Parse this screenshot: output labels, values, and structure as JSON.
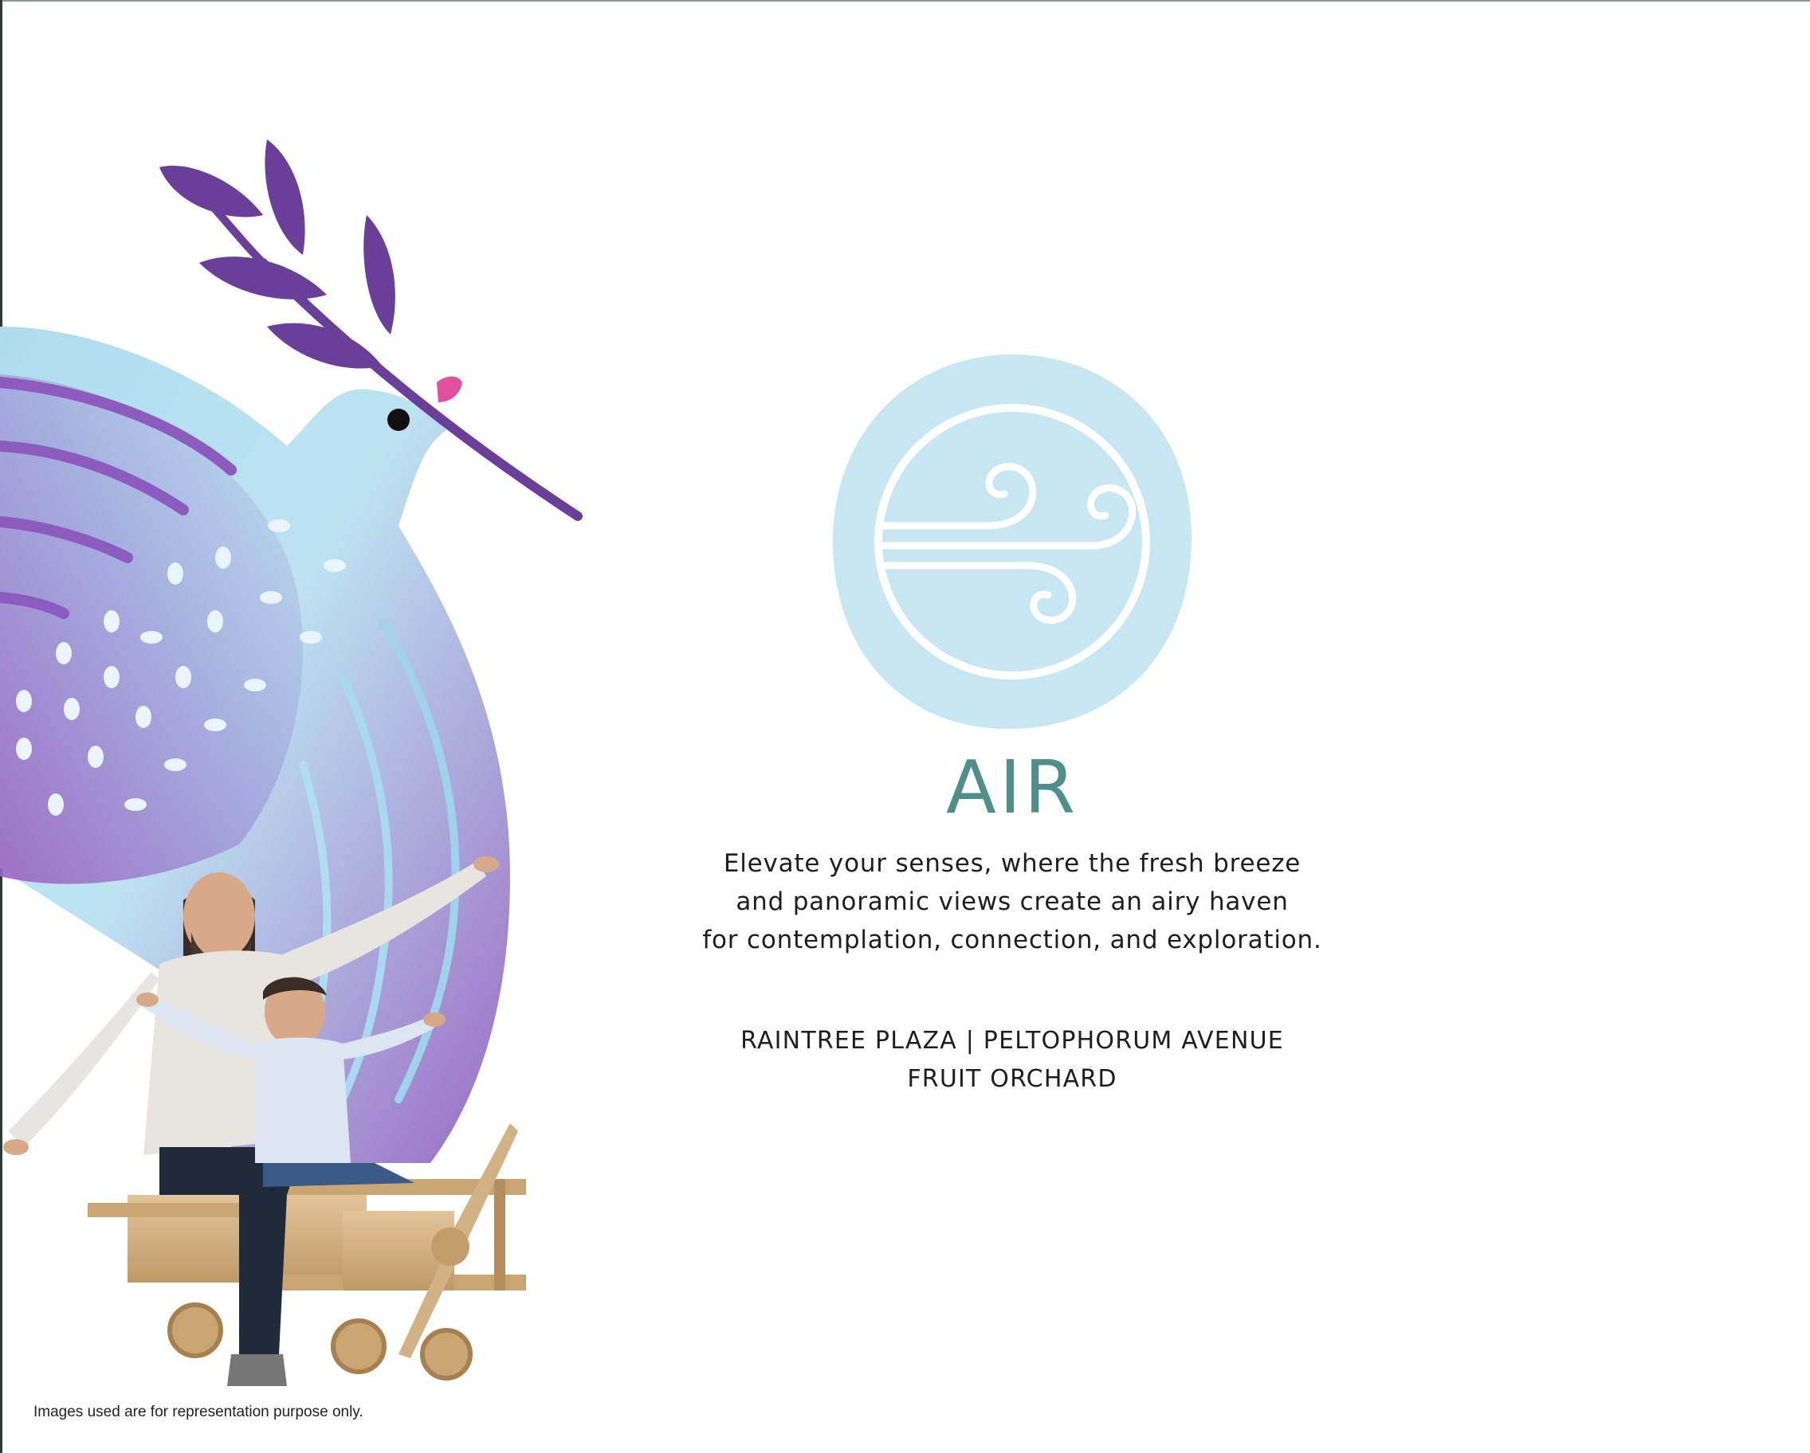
{
  "section": {
    "title": "AIR",
    "description_lines": [
      "Elevate your senses, where the fresh breeze",
      "and panoramic views create an airy haven",
      "for contemplation, connection, and exploration."
    ],
    "location_lines": [
      "RAINTREE PLAZA | PELTOPHORUM AVENUE",
      "FRUIT ORCHARD"
    ]
  },
  "disclaimer": "Images used are for representation purpose only.",
  "icons": {
    "element": "wind-icon",
    "illustration": "dove-with-olive-branch-illustration",
    "photo": "father-and-child-on-wooden-toy-plane-photo"
  },
  "colors": {
    "title": "#4e8f8b",
    "icon_circle": "#c6e6f2",
    "dove_light": "#b8e1f0",
    "dove_purple": "#9b6cc4",
    "branch": "#6a3f9a",
    "beak": "#e0509c",
    "text": "#1e1e1e"
  }
}
